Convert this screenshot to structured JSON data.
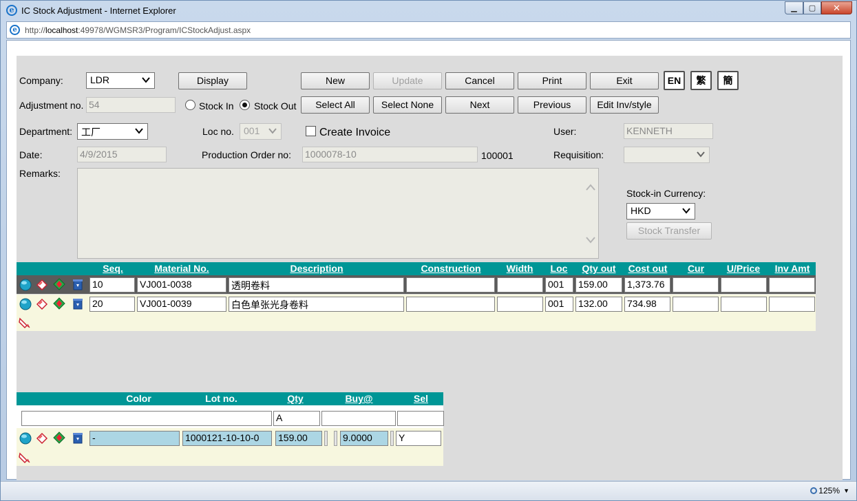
{
  "window": {
    "title": "IC Stock Adjustment - Internet Explorer",
    "url_prefix": "http://",
    "url_host": "localhost",
    "url_rest": ":49978/WGMSR3/Program/ICStockAdjust.aspx",
    "zoom": "125%"
  },
  "toolbar": {
    "display": "Display",
    "new": "New",
    "update": "Update",
    "cancel": "Cancel",
    "print": "Print",
    "exit": "Exit",
    "lang_en": "EN",
    "lang_trad": "繁",
    "lang_simp": "簡",
    "select_all": "Select All",
    "select_none": "Select None",
    "next": "Next",
    "previous": "Previous",
    "edit_inv": "Edit Inv/style",
    "stock_transfer": "Stock Transfer"
  },
  "form": {
    "company_label": "Company:",
    "company_value": "LDR",
    "adjustment_label": "Adjustment no.",
    "adjustment_value": "54",
    "stock_in_label": "Stock In",
    "stock_out_label": "Stock Out",
    "department_label": "Department:",
    "department_value": "工厂",
    "loc_label": "Loc no.",
    "loc_value": "001",
    "create_invoice_label": "Create Invoice",
    "user_label": "User:",
    "user_value": "KENNETH",
    "date_label": "Date:",
    "date_value": "4/9/2015",
    "production_label": "Production Order no:",
    "production_value": "1000078-10",
    "production_code": "100001",
    "requisition_label": "Requisition:",
    "requisition_value": "",
    "remarks_label": "Remarks:",
    "currency_label": "Stock-in Currency:",
    "currency_value": "HKD"
  },
  "main_grid": {
    "headers": {
      "seq": "Seq.",
      "material": "Material No.",
      "description": "Description",
      "construction": "Construction",
      "width": "Width",
      "loc": "Loc",
      "qty_out": "Qty out",
      "cost_out": "Cost out",
      "cur": "Cur",
      "uprice": "U/Price",
      "inv_amt": "Inv Amt"
    },
    "rows": [
      {
        "seq": "10",
        "material": "VJ001-0038",
        "description": "透明卷料",
        "construction": "",
        "width": "",
        "loc": "001",
        "qty_out": "159.00",
        "cost_out": "1,373.76",
        "cur": "",
        "uprice": "",
        "inv_amt": ""
      },
      {
        "seq": "20",
        "material": "VJ001-0039",
        "description": "白色单张光身卷料",
        "construction": "",
        "width": "",
        "loc": "001",
        "qty_out": "132.00",
        "cost_out": "734.98",
        "cur": "",
        "uprice": "",
        "inv_amt": ""
      }
    ]
  },
  "sub_grid": {
    "headers": {
      "color": "Color",
      "lot": "Lot no.",
      "qty": "Qty",
      "buy": "Buy@",
      "sel": "Sel"
    },
    "filter": {
      "color": "",
      "qty": "A",
      "buy": "",
      "sel": ""
    },
    "rows": [
      {
        "color": "-",
        "lot": "1000121-10-10-0",
        "qty": "159.00",
        "buy": "9.0000",
        "sel": "Y"
      }
    ]
  },
  "icons": {
    "row_select": "globe-icon",
    "row_edit": "eraser-icon",
    "row_move": "diamond-arrows-icon",
    "row_delete": "recycle-bin-icon",
    "add_row": "pencil-add-icon"
  }
}
